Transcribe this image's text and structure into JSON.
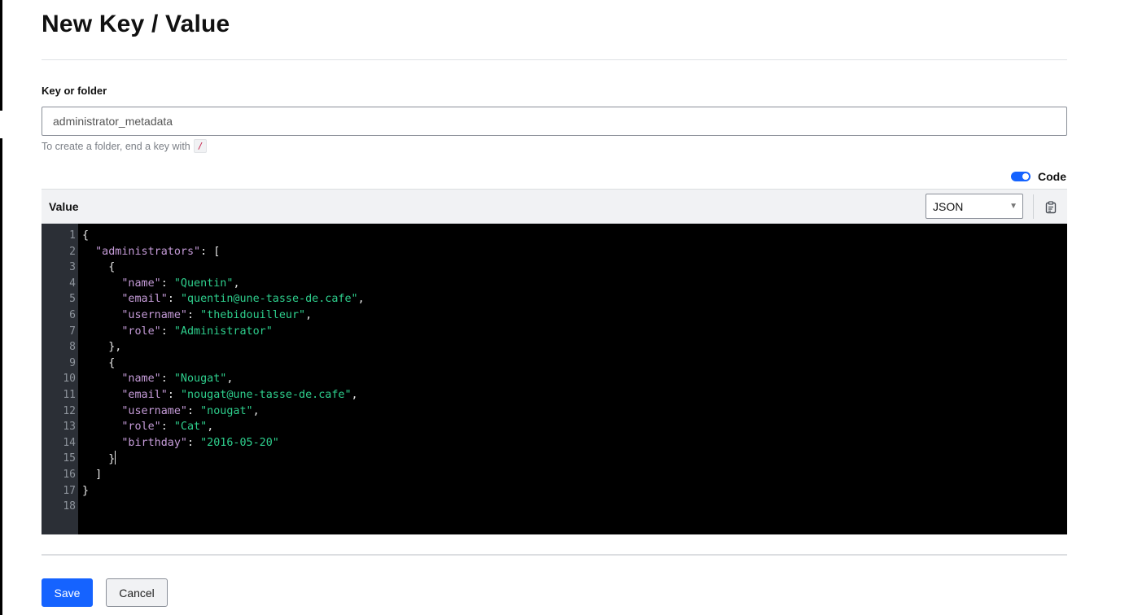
{
  "page": {
    "title": "New Key / Value"
  },
  "key_field": {
    "label": "Key or folder",
    "value": "administrator_metadata",
    "help_text": "To create a folder, end a key with",
    "help_code": "/"
  },
  "code_toggle": {
    "label": "Code",
    "enabled": true
  },
  "editor": {
    "title": "Value",
    "language": "JSON",
    "copy_icon": "clipboard-icon",
    "lines": [
      [
        {
          "t": "p",
          "v": "{"
        }
      ],
      [
        {
          "t": "p",
          "v": "  "
        },
        {
          "t": "k",
          "v": "\"administrators\""
        },
        {
          "t": "p",
          "v": ": ["
        }
      ],
      [
        {
          "t": "p",
          "v": "    {"
        }
      ],
      [
        {
          "t": "p",
          "v": "      "
        },
        {
          "t": "k",
          "v": "\"name\""
        },
        {
          "t": "p",
          "v": ": "
        },
        {
          "t": "s",
          "v": "\"Quentin\""
        },
        {
          "t": "p",
          "v": ","
        }
      ],
      [
        {
          "t": "p",
          "v": "      "
        },
        {
          "t": "k",
          "v": "\"email\""
        },
        {
          "t": "p",
          "v": ": "
        },
        {
          "t": "s",
          "v": "\"quentin@une-tasse-de.cafe\""
        },
        {
          "t": "p",
          "v": ","
        }
      ],
      [
        {
          "t": "p",
          "v": "      "
        },
        {
          "t": "k",
          "v": "\"username\""
        },
        {
          "t": "p",
          "v": ": "
        },
        {
          "t": "s",
          "v": "\"thebidouilleur\""
        },
        {
          "t": "p",
          "v": ","
        }
      ],
      [
        {
          "t": "p",
          "v": "      "
        },
        {
          "t": "k",
          "v": "\"role\""
        },
        {
          "t": "p",
          "v": ": "
        },
        {
          "t": "s",
          "v": "\"Administrator\""
        }
      ],
      [
        {
          "t": "p",
          "v": "    },"
        }
      ],
      [
        {
          "t": "p",
          "v": "    {"
        }
      ],
      [
        {
          "t": "p",
          "v": "      "
        },
        {
          "t": "k",
          "v": "\"name\""
        },
        {
          "t": "p",
          "v": ": "
        },
        {
          "t": "s",
          "v": "\"Nougat\""
        },
        {
          "t": "p",
          "v": ","
        }
      ],
      [
        {
          "t": "p",
          "v": "      "
        },
        {
          "t": "k",
          "v": "\"email\""
        },
        {
          "t": "p",
          "v": ": "
        },
        {
          "t": "s",
          "v": "\"nougat@une-tasse-de.cafe\""
        },
        {
          "t": "p",
          "v": ","
        }
      ],
      [
        {
          "t": "p",
          "v": "      "
        },
        {
          "t": "k",
          "v": "\"username\""
        },
        {
          "t": "p",
          "v": ": "
        },
        {
          "t": "s",
          "v": "\"nougat\""
        },
        {
          "t": "p",
          "v": ","
        }
      ],
      [
        {
          "t": "p",
          "v": "      "
        },
        {
          "t": "k",
          "v": "\"role\""
        },
        {
          "t": "p",
          "v": ": "
        },
        {
          "t": "s",
          "v": "\"Cat\""
        },
        {
          "t": "p",
          "v": ","
        }
      ],
      [
        {
          "t": "p",
          "v": "      "
        },
        {
          "t": "k",
          "v": "\"birthday\""
        },
        {
          "t": "p",
          "v": ": "
        },
        {
          "t": "s",
          "v": "\"2016-05-20\""
        }
      ],
      [
        {
          "t": "p",
          "v": "    }"
        }
      ],
      [
        {
          "t": "p",
          "v": "  ]"
        }
      ],
      [
        {
          "t": "p",
          "v": "}"
        }
      ],
      []
    ],
    "cursor_line": 15
  },
  "actions": {
    "save_label": "Save",
    "cancel_label": "Cancel"
  },
  "colors": {
    "accent": "#1563ff",
    "json_key": "#c59bd8",
    "json_string": "#2ecf8d"
  }
}
